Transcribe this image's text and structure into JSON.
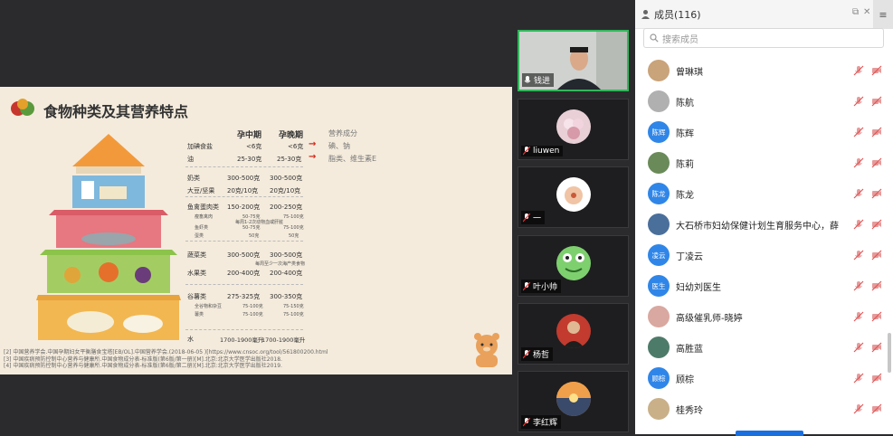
{
  "slide": {
    "title": "食物种类及其营养特点",
    "headers": {
      "mid": "孕中期",
      "late": "孕晚期",
      "nutrients": "营养成分"
    },
    "rows": [
      {
        "name": "加碘食盐",
        "mid": "<6克",
        "late": "<6克"
      },
      {
        "name": "油",
        "mid": "25-30克",
        "late": "25-30克"
      },
      {
        "name": "奶类",
        "mid": "300-500克",
        "late": "300-500克"
      },
      {
        "name": "大豆/坚果",
        "mid": "20克/10克",
        "late": "20克/10克"
      },
      {
        "name": "鱼禽蛋肉类",
        "mid": "150-200克",
        "late": "200-250克"
      },
      {
        "name": "蔬菜类",
        "mid": "300-500克",
        "late": "300-500克"
      },
      {
        "name": "水果类",
        "mid": "200-400克",
        "late": "200-400克"
      },
      {
        "name": "谷薯类",
        "mid": "275-325克",
        "late": "300-350克"
      },
      {
        "name": "水",
        "mid": "1700-1900毫升",
        "late": "1700-1900毫升"
      }
    ],
    "nutrient_notes": [
      "碘、钠",
      "脂类、维生素E"
    ],
    "sub_rows": [
      {
        "name": "瘦畜禽肉",
        "mid": "50-75克",
        "late": "75-100克"
      },
      {
        "name": "鱼虾类",
        "mid": "50-75克",
        "late": "75-100克"
      },
      {
        "name": "蛋类",
        "mid": "50克",
        "late": "50克"
      },
      {
        "name": "全谷物和杂豆",
        "mid": "75-100克",
        "late": "75-150克"
      },
      {
        "name": "薯类",
        "mid": "75-100克",
        "late": "75-100克"
      }
    ],
    "small_notes": [
      "每周1-2次动物血或肝脏",
      "每周至少一次海产类食物"
    ],
    "references": [
      "[2] 中国营养学会.中国孕期妇女平衡膳食宝塔[EB/OL].中国营养学会.(2018-06-05 )[https://www.cnsoc.org/tool/561800200.html",
      "[3] 中国疾病预防控制中心营养与健康所.中国食物成分表-标准版(第6版/第一册)[M].北京:北京大学医学出版社2018.",
      "[4] 中国疾病预防控制中心营养与健康所.中国食物成分表-标准版(第6版/第二册)[M].北京:北京大学医学出版社2019."
    ]
  },
  "videos": [
    {
      "name": "钱进",
      "type": "camera",
      "active": true
    },
    {
      "name": "liuwen",
      "type": "avatar",
      "color": "#e8d0d6"
    },
    {
      "name": "一",
      "type": "avatar",
      "color": "#ffffff"
    },
    {
      "name": "叶小帅",
      "type": "avatar",
      "color": "#7ed06f"
    },
    {
      "name": "杨哲",
      "type": "avatar",
      "color": "#c23b2e"
    },
    {
      "name": "李红辉",
      "type": "avatar",
      "color": "#e58a3a"
    }
  ],
  "panel": {
    "title": "成员(116)",
    "search_placeholder": "搜索成员",
    "members": [
      {
        "name": "曾琳琪",
        "avatar_text": "",
        "color": "#c9a37a"
      },
      {
        "name": "陈航",
        "avatar_text": "",
        "color": "#b0b0b0"
      },
      {
        "name": "陈辉",
        "avatar_text": "陈辉",
        "color": "#2f86e8"
      },
      {
        "name": "陈莉",
        "avatar_text": "",
        "color": "#6a8a5a"
      },
      {
        "name": "陈龙",
        "avatar_text": "陈龙",
        "color": "#2f86e8"
      },
      {
        "name": "大石桥市妇幼保健计划生育服务中心，薛",
        "avatar_text": "",
        "color": "#4a6f9a"
      },
      {
        "name": "丁凌云",
        "avatar_text": "凌云",
        "color": "#2f86e8"
      },
      {
        "name": "妇幼刘医生",
        "avatar_text": "医生",
        "color": "#2f86e8"
      },
      {
        "name": "高级催乳师-晓婷",
        "avatar_text": "",
        "color": "#d9a8a0"
      },
      {
        "name": "高胜蓝",
        "avatar_text": "",
        "color": "#4d7b6a"
      },
      {
        "name": "顾棕",
        "avatar_text": "顾棕",
        "color": "#2f86e8"
      },
      {
        "name": "桂秀玲",
        "avatar_text": "",
        "color": "#c9b089"
      }
    ]
  }
}
